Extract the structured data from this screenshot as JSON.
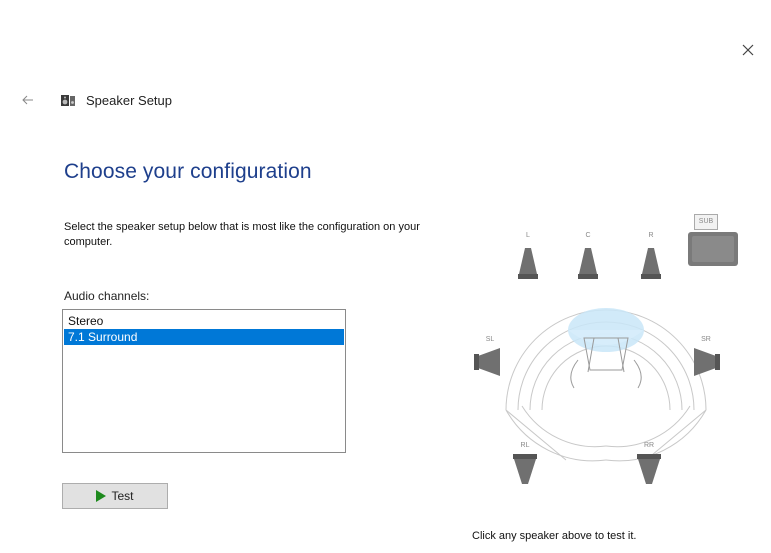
{
  "window": {
    "title": "Speaker Setup",
    "close_glyph": "×",
    "back_glyph": "←"
  },
  "page": {
    "heading": "Choose your configuration",
    "instructions": "Select the speaker setup below that is most like the configuration on your computer.",
    "channels_label": "Audio channels:",
    "channels": [
      {
        "label": "Stereo",
        "selected": false
      },
      {
        "label": "7.1 Surround",
        "selected": true
      }
    ],
    "test_button_label": "Test",
    "hint": "Click any speaker above to test it."
  },
  "speakers": {
    "front_left": "L",
    "center": "C",
    "front_right": "R",
    "subwoofer": "SUB",
    "side_left": "SL",
    "side_right": "SR",
    "rear_left": "RL",
    "rear_right": "RR"
  },
  "icons": {
    "close": "close-icon",
    "back": "back-arrow-icon",
    "app": "speaker-setup-icon",
    "play": "play-icon"
  },
  "colors": {
    "heading": "#1e3f8c",
    "selection": "#0078d7",
    "play": "#1d8a1d",
    "listening_zone": "#c9e6f8"
  }
}
